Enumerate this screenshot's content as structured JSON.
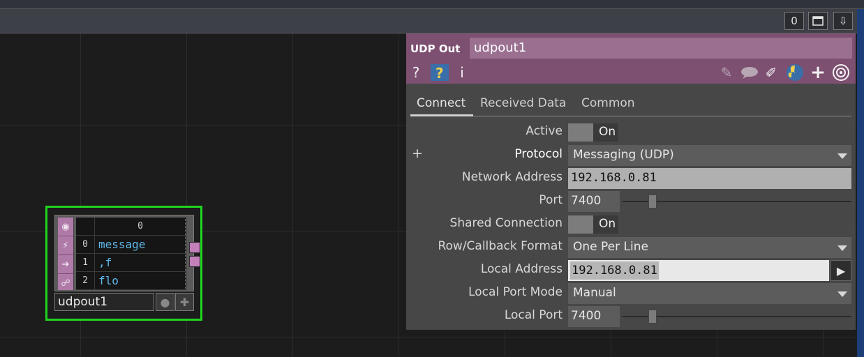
{
  "topbar": {
    "counter": "0",
    "maximize_icon": "window-icon",
    "pin_icon": "pin-down-icon"
  },
  "node": {
    "name": "udpout1",
    "header_col": "0",
    "rows": [
      {
        "index": "0",
        "value": "message"
      },
      {
        "index": "1",
        "value": ",f"
      },
      {
        "index": "2",
        "value": "flo"
      }
    ],
    "side_icons": [
      "target-icon",
      "lightning-icon",
      "arrow-right-icon",
      "python-icon"
    ]
  },
  "panel": {
    "op_type": "UDP Out",
    "op_name": "udpout1",
    "tabs": [
      "Connect",
      "Received Data",
      "Common"
    ],
    "params": {
      "active": {
        "label": "Active",
        "value": "On"
      },
      "protocol": {
        "label": "Protocol",
        "value": "Messaging (UDP)"
      },
      "network_address": {
        "label": "Network Address",
        "value": "192.168.0.81"
      },
      "port": {
        "label": "Port",
        "value": "7400"
      },
      "shared_connection": {
        "label": "Shared Connection",
        "value": "On"
      },
      "row_callback_format": {
        "label": "Row/Callback Format",
        "value": "One Per Line"
      },
      "local_address": {
        "label": "Local Address",
        "value": "192.168.0.81"
      },
      "local_port_mode": {
        "label": "Local Port Mode",
        "value": "Manual"
      },
      "local_port": {
        "label": "Local Port",
        "value": "7400"
      }
    }
  },
  "colors": {
    "accent": "#7d4f71",
    "node_selected": "#1fd41f",
    "op_family": "#b07aa8"
  }
}
